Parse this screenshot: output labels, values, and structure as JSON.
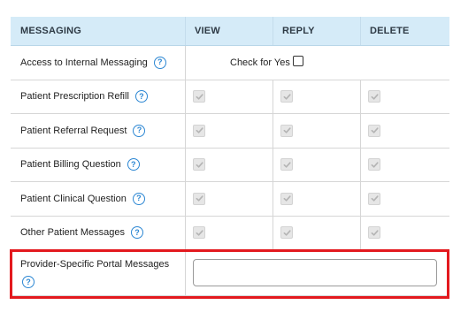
{
  "header": {
    "col1": "MESSAGING",
    "col2": "VIEW",
    "col3": "REPLY",
    "col4": "DELETE"
  },
  "internal": {
    "label": "Access to Internal Messaging",
    "check_text": "Check for Yes",
    "checked": false
  },
  "rows": [
    {
      "label": "Patient Prescription Refill",
      "view": true,
      "reply": true,
      "delete": true,
      "disabled": true
    },
    {
      "label": "Patient Referral Request",
      "view": true,
      "reply": true,
      "delete": true,
      "disabled": true
    },
    {
      "label": "Patient Billing Question",
      "view": true,
      "reply": true,
      "delete": true,
      "disabled": true
    },
    {
      "label": "Patient Clinical Question",
      "view": true,
      "reply": true,
      "delete": true,
      "disabled": true
    },
    {
      "label": "Other Patient Messages",
      "view": true,
      "reply": true,
      "delete": true,
      "disabled": true
    }
  ],
  "provider": {
    "label": "Provider-Specific Portal Messages",
    "input_value": ""
  },
  "help_glyph": "?",
  "colors": {
    "header_bg": "#d5ebf8",
    "help_blue": "#2c87d3",
    "highlight_red": "#e3191e"
  },
  "icons": {
    "help": "help-circle-icon",
    "check": "checkmark-icon"
  }
}
